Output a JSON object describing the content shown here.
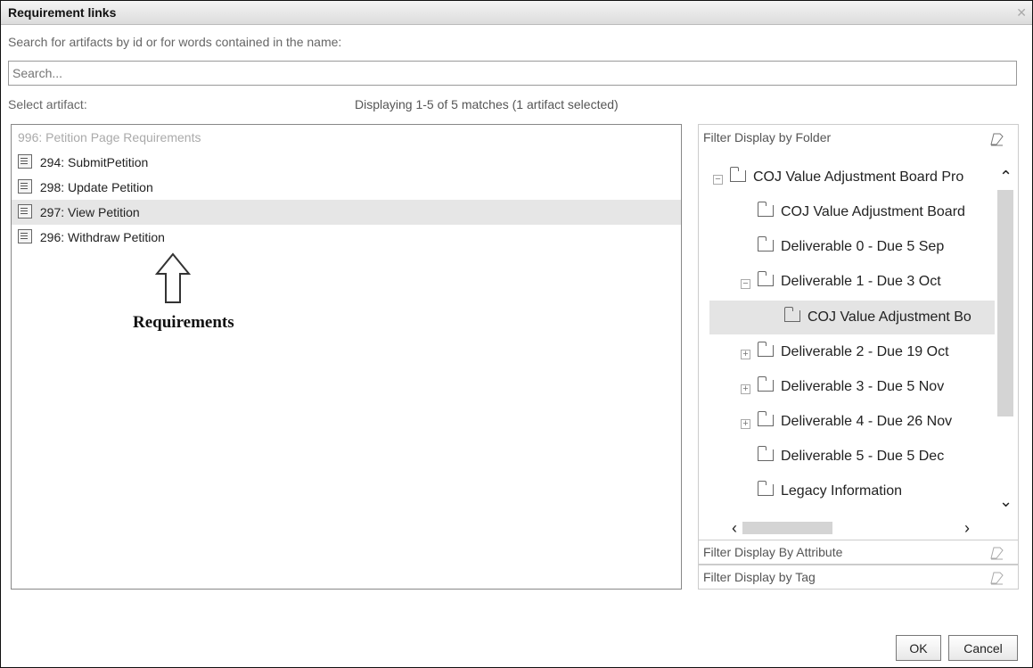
{
  "dialog": {
    "title": "Requirement links",
    "close_icon": "✕"
  },
  "search": {
    "label": "Search for artifacts by id or for words contained in the name:",
    "placeholder": "Search...",
    "value": ""
  },
  "selection": {
    "label": "Select artifact:",
    "match_text": "Displaying 1-5 of 5 matches (1 artifact selected)"
  },
  "artifacts": [
    {
      "label": "996: Petition Page Requirements",
      "state": "parent"
    },
    {
      "label": "294: SubmitPetition",
      "state": "normal"
    },
    {
      "label": "298: Update Petition",
      "state": "normal"
    },
    {
      "label": "297: View Petition",
      "state": "selected"
    },
    {
      "label": "296: Withdraw Petition",
      "state": "normal"
    }
  ],
  "annotation": {
    "label": "Requirements"
  },
  "filters": {
    "folder": {
      "header": "Filter Display by Folder",
      "clear_icon": "eraser-icon",
      "items": [
        {
          "label": "COJ Value Adjustment Board Pro",
          "toggle": "minus"
        },
        {
          "label": "COJ Value Adjustment Board",
          "toggle": ""
        },
        {
          "label": "Deliverable 0 - Due 5 Sep",
          "toggle": ""
        },
        {
          "label": "Deliverable 1 - Due 3 Oct",
          "toggle": "minus"
        },
        {
          "label": "COJ Value Adjustment Bo",
          "toggle": "",
          "selected": true
        },
        {
          "label": "Deliverable 2 - Due 19 Oct",
          "toggle": "plus"
        },
        {
          "label": "Deliverable 3 - Due 5 Nov",
          "toggle": "plus"
        },
        {
          "label": "Deliverable 4 - Due 26 Nov",
          "toggle": "plus"
        },
        {
          "label": "Deliverable 5 - Due 5 Dec",
          "toggle": ""
        },
        {
          "label": "Legacy Information",
          "toggle": ""
        }
      ]
    },
    "attribute": {
      "header": "Filter Display By Attribute"
    },
    "tag": {
      "header": "Filter Display by Tag"
    }
  },
  "buttons": {
    "ok": "OK",
    "cancel": "Cancel"
  },
  "colors": {
    "selected_row": "#e6e6e6",
    "border": "#888888"
  }
}
